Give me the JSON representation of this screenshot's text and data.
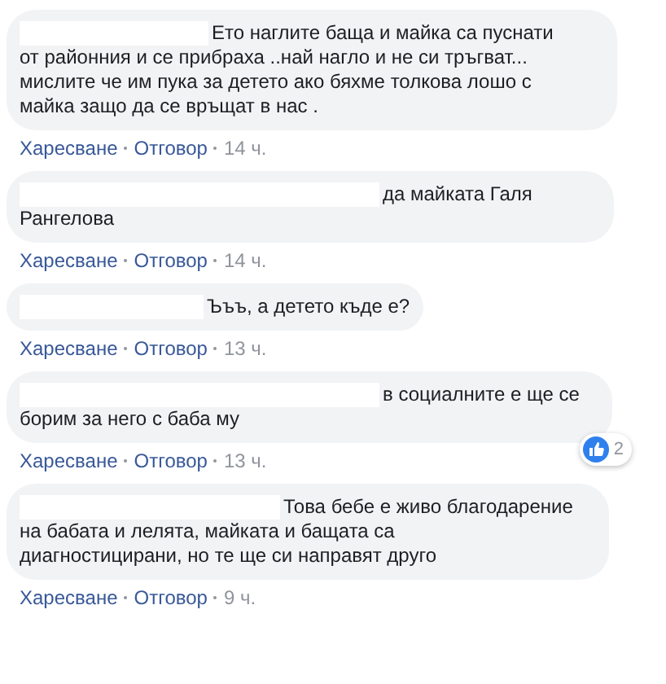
{
  "comments": [
    {
      "lines": [
        "Ето наглите баща и майка са пуснати",
        "от районния и се прибраха ..най нагло и не си тръгват...",
        "мислите че им пука за детето ако бяхме толкова лошо с",
        "майка защо да се връщат в нас ."
      ],
      "actions": [
        "Харесване",
        "Отговор"
      ],
      "time": "14 ч."
    },
    {
      "lines": [
        "да майката Галя",
        "Рангелова"
      ],
      "actions": [
        "Харесване",
        "Отговор"
      ],
      "time": "14 ч."
    },
    {
      "lines": [
        "Ъъъ, а детето къде е?"
      ],
      "actions": [
        "Харесване",
        "Отговор"
      ],
      "time": "13 ч."
    },
    {
      "lines": [
        "в социалните е ще се",
        "борим за него с баба му"
      ],
      "actions": [
        "Харесване",
        "Отговор"
      ],
      "time": "13 ч.",
      "reactions": "2"
    },
    {
      "lines": [
        "Това бебе е живо благодарение",
        "на бабата и лелята, майката и бащата са",
        "диагностицирани, но те ще си направят друго"
      ],
      "actions": [
        "Харесване",
        "Отговор"
      ],
      "time": "9 ч."
    }
  ]
}
